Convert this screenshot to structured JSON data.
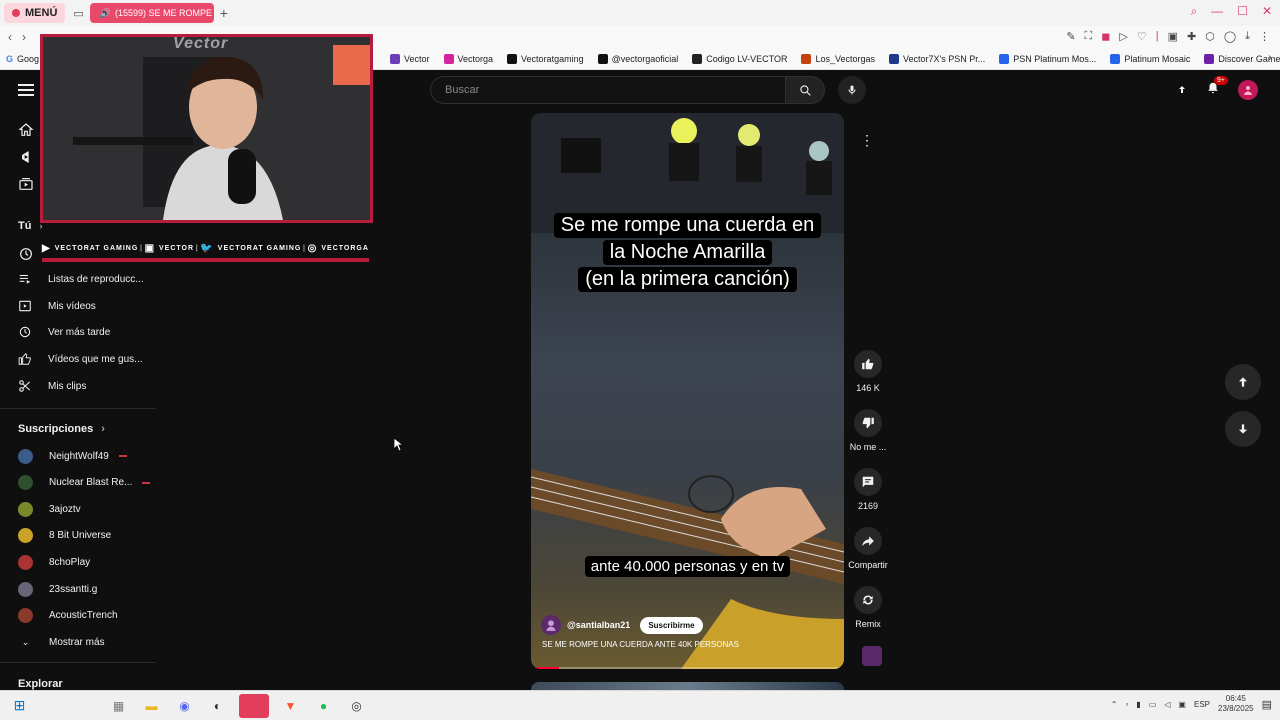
{
  "browser": {
    "menu_label": "MENÚ",
    "active_tab_title": "(15599) SE ME ROMPE",
    "bookmarks_first": "Goog",
    "bookmarks": [
      {
        "label": "Vector",
        "color": "#6a3fb5"
      },
      {
        "label": "Vectorga",
        "color": "#d6249f"
      },
      {
        "label": "Vectoratgaming",
        "color": "#111111"
      },
      {
        "label": "@vectorgaoficial",
        "color": "#111111"
      },
      {
        "label": "Codigo LV-VECTOR",
        "color": "#222222"
      },
      {
        "label": "Los_Vectorgas",
        "color": "#c2410c"
      },
      {
        "label": "Vector7X's PSN Pr...",
        "color": "#1e3a8a"
      },
      {
        "label": "PSN Platinum Mos...",
        "color": "#2563eb"
      },
      {
        "label": "Platinum Mosaic",
        "color": "#2563eb"
      },
      {
        "label": "Discover Games -...",
        "color": "#6b21a8"
      }
    ]
  },
  "youtube": {
    "search_placeholder": "Buscar",
    "notifications_badge": "9+",
    "sidebar": {
      "you_heading": "Tú",
      "items": [
        {
          "label": "Listas de reproducc...",
          "icon": "playlist-icon"
        },
        {
          "label": "Mis vídeos",
          "icon": "my-videos-icon"
        },
        {
          "label": "Ver más tarde",
          "icon": "watch-later-icon"
        },
        {
          "label": "Vídeos que me gus...",
          "icon": "like-icon"
        },
        {
          "label": "Mis clips",
          "icon": "clips-icon"
        }
      ],
      "subscriptions_heading": "Suscripciones",
      "subscriptions": [
        {
          "name": "NeightWolf49",
          "color": "#3b5b8a",
          "live": true
        },
        {
          "name": "Nuclear Blast Re...",
          "color": "#2f4f2f",
          "live": true
        },
        {
          "name": "3ajoztv",
          "color": "#7a8a2a",
          "live": false
        },
        {
          "name": "8 Bit Universe",
          "color": "#c9a227",
          "live": false
        },
        {
          "name": "8choPlay",
          "color": "#a33",
          "live": false
        },
        {
          "name": "23ssantti.g",
          "color": "#667",
          "live": false
        },
        {
          "name": "AcousticTrench",
          "color": "#8a3a2a",
          "live": false
        }
      ],
      "show_more": "Mostrar más",
      "explore_heading": "Explorar"
    },
    "webcam": {
      "watermark": "Vector",
      "socials": [
        {
          "label": "VECTORAT GAMING",
          "icon": "youtube-icon"
        },
        {
          "label": "VECTOR",
          "icon": "twitch-icon"
        },
        {
          "label": "VECTORAT GAMING",
          "icon": "twitter-icon"
        },
        {
          "label": "VECTORGA",
          "icon": "instagram-icon"
        }
      ]
    },
    "short": {
      "caption_top_lines": [
        "Se me rompe una cuerda en",
        "la Noche Amarilla",
        "(en la primera canción)"
      ],
      "caption_bottom": "ante 40.000 personas y en tv",
      "channel": "@santialban21",
      "subscribe_label": "Suscribirme",
      "title": "SE ME ROMPE UNA CUERDA ANTE 40K PERSONAS",
      "progress": 0.09
    },
    "actions": {
      "likes": "146 K",
      "dislike_label": "No me ...",
      "comments": "2169",
      "share_label": "Compartir",
      "remix_label": "Remix"
    }
  },
  "taskbar": {
    "language": "ESP",
    "time": "06:45",
    "date": "23/8/2025"
  },
  "colors": {
    "accent": "#e23d5b",
    "youtube_bg": "#0f0f0f",
    "webcam_border": "#b81c3d"
  }
}
